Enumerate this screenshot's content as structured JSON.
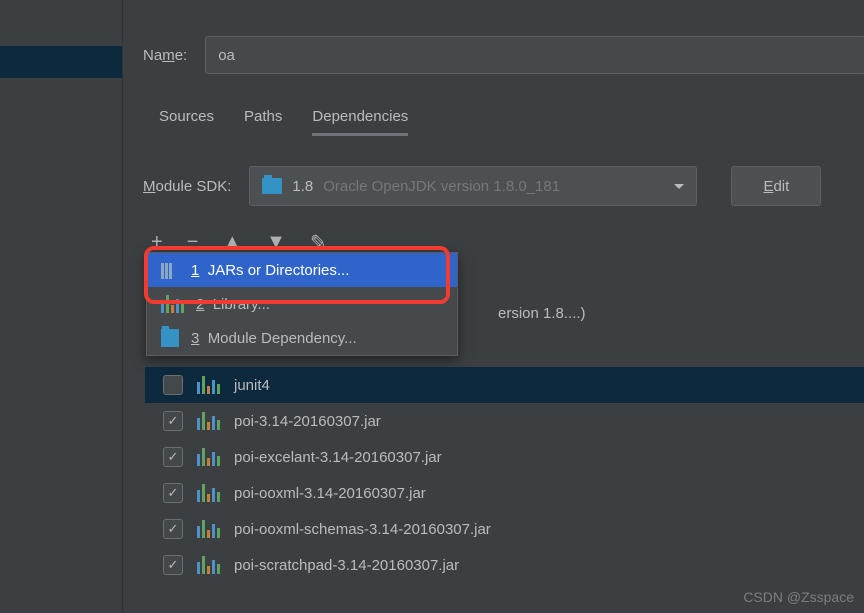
{
  "name_label_pre": "Na",
  "name_label_u": "m",
  "name_label_post": "e:",
  "name_value": "oa",
  "tabs": {
    "sources": "Sources",
    "paths": "Paths",
    "dependencies": "Dependencies"
  },
  "sdk_label_u": "M",
  "sdk_label_post": "odule SDK:",
  "sdk_version": "1.8",
  "sdk_detail": "Oracle OpenJDK version 1.8.0_181",
  "edit_u": "E",
  "edit_post": "dit",
  "popup": {
    "jars_num": "1",
    "jars": "JARs or Directories...",
    "lib_num": "2",
    "lib": "Library...",
    "mod_num": "3",
    "mod": "Module Dependency..."
  },
  "truncated": "ersion 1.8....)",
  "deps": {
    "junit": "junit4",
    "poi": "poi-3.14-20160307.jar",
    "excelant": "poi-excelant-3.14-20160307.jar",
    "ooxml": "poi-ooxml-3.14-20160307.jar",
    "schemas": "poi-ooxml-schemas-3.14-20160307.jar",
    "scratch": "poi-scratchpad-3.14-20160307.jar"
  },
  "watermark": "CSDN @Zsspace"
}
